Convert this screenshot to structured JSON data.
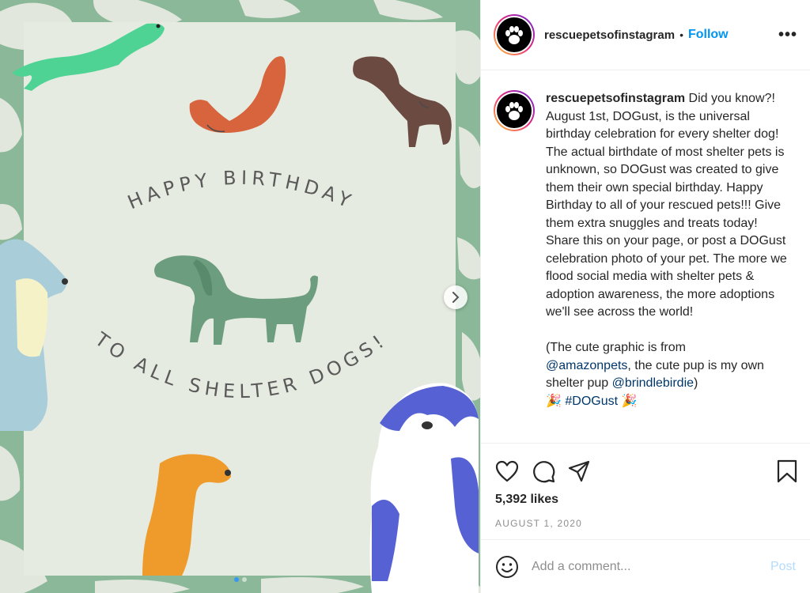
{
  "post": {
    "image": {
      "arc_top": "HAPPY BIRTHDAY",
      "arc_bottom": "TO ALL SHELTER DOGS!",
      "dots": 2,
      "active_dot": 0
    }
  },
  "header": {
    "username": "rescuepetsofinstagram",
    "separator": "•",
    "follow_label": "Follow",
    "more_label": "•••"
  },
  "caption": {
    "username": "rescuepetsofinstagram",
    "text": "Did you know?! August 1st, DOGust, is the universal birthday celebration for every shelter dog! The actual birthdate of most shelter pets is unknown, so DOGust was created to give them their own special birthday. Happy Birthday to all of your rescued pets!!! Give them extra snuggles and treats today!\nShare this on your page, or post a DOGust celebration photo of your pet. The more we flood social media with shelter pets & adoption awareness, the more adoptions we'll see across the world!",
    "credit_prefix": "(The cute graphic is from",
    "mention_1": "@amazonpets",
    "credit_middle": ", the cute pup is my own shelter pup",
    "mention_2": "@brindlebirdie",
    "credit_suffix": ")",
    "hashtag_line": "🎉 #DOGust 🎉"
  },
  "actions": {
    "likes": "5,392 likes",
    "date": "August 1, 2020"
  },
  "comment": {
    "placeholder": "Add a comment...",
    "post_label": "Post"
  },
  "colors": {
    "accent": "#0095f6",
    "post_disabled": "#b3dbff",
    "card_bg": "#e6ebe1",
    "camo_bg": "#8bb898"
  }
}
